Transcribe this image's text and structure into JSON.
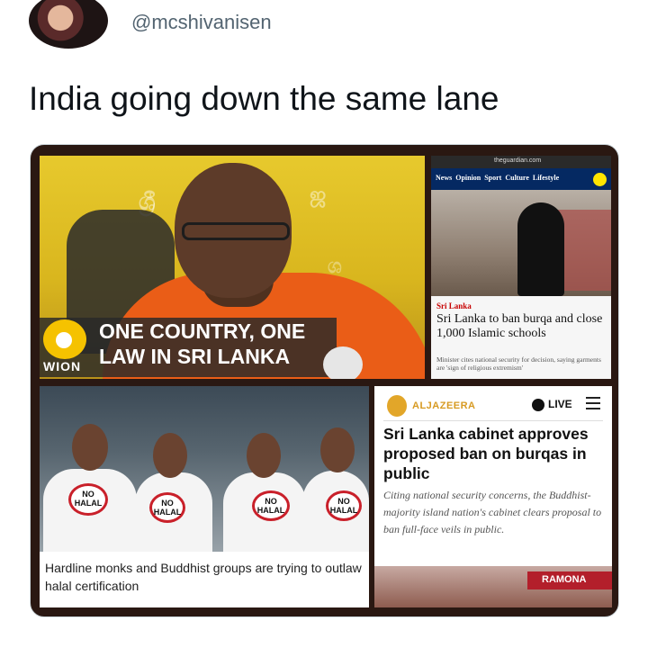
{
  "tweet": {
    "handle": "@mcshivanisen",
    "text": "India going down the same lane"
  },
  "panels": {
    "wion": {
      "headline_line1": "ONE COUNTRY, ONE",
      "headline_line2": "LAW IN SRI LANKA",
      "channel": "WION"
    },
    "guardian": {
      "url": "theguardian.com",
      "nav": "News  Opinion  Sport  Culture  Lifestyle",
      "kicker": "Sri Lanka",
      "headline": "Sri Lanka to ban burqa and close 1,000 Islamic schools",
      "standfirst": "Minister cites national security for decision, saying garments are 'sign of religious extremism'"
    },
    "halal": {
      "badge_text": "NO HALAL",
      "caption": "Hardline monks and Buddhist groups are trying to outlaw halal certification"
    },
    "aljazeera": {
      "brand": "ALJAZEERA",
      "live_label": "LIVE",
      "headline": "Sri Lanka cabinet approves proposed ban on burqas in public",
      "standfirst": "Citing national security concerns, the Buddhist-majority island nation's cabinet clears proposal to ban full-face veils in public.",
      "sign_text": "RAMONA"
    }
  }
}
